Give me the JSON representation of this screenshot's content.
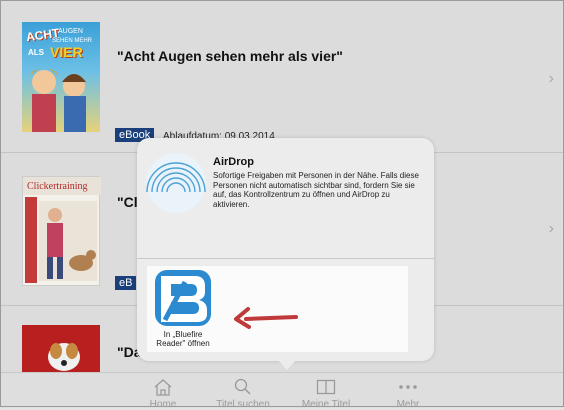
{
  "books": [
    {
      "title": "\"Acht Augen sehen mehr als vier\"",
      "badge": "eBook",
      "expiry": "Ablaufdatum:  09.03.2014",
      "cover_text": [
        "ACHT",
        "AUGEN",
        "SEHEN MEHR",
        "ALS",
        "VIER"
      ]
    },
    {
      "title": "\"Cli",
      "badge": "eB",
      "cover_text": [
        "Clickertraining"
      ]
    },
    {
      "title": "\"Da"
    }
  ],
  "share_sheet": {
    "airdrop_title": "AirDrop",
    "airdrop_description": "Sofortige Freigaben mit Personen in der Nähe. Falls diese Personen nicht automatisch sichtbar sind, fordern Sie sie auf, das Kontrollzentrum zu öffnen und AirDrop zu aktivieren.",
    "app_label_line1": "In „Bluefire",
    "app_label_line2": "Reader\" öffnen"
  },
  "tabs": [
    {
      "label": "Home",
      "icon": "home-icon"
    },
    {
      "label": "Titel suchen",
      "icon": "search-icon"
    },
    {
      "label": "Meine Titel",
      "icon": "book-icon"
    },
    {
      "label": "Mehr",
      "icon": "more-icon"
    }
  ],
  "colors": {
    "ebook_badge": "#1a3f7a",
    "bluefire_icon": "#2b8ad0",
    "annotation_arrow": "#c0393b"
  }
}
